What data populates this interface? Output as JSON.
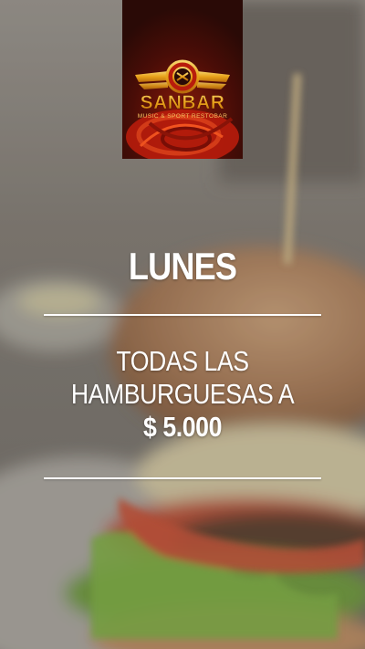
{
  "brand": {
    "name": "SANBAR",
    "tagline": "MUSIC & SPORT RESTOBAR"
  },
  "promo": {
    "day": "LUNES",
    "line1": "TODAS LAS",
    "line2": "HAMBURGUESAS A",
    "price": "$ 5.000"
  },
  "colors": {
    "logo_background": "#2a0a06",
    "logo_red": "#c0200e",
    "logo_gold": "#e8a21a",
    "text": "#ffffff"
  },
  "icons": {
    "logo_emblem": "winged-crest-icon"
  }
}
